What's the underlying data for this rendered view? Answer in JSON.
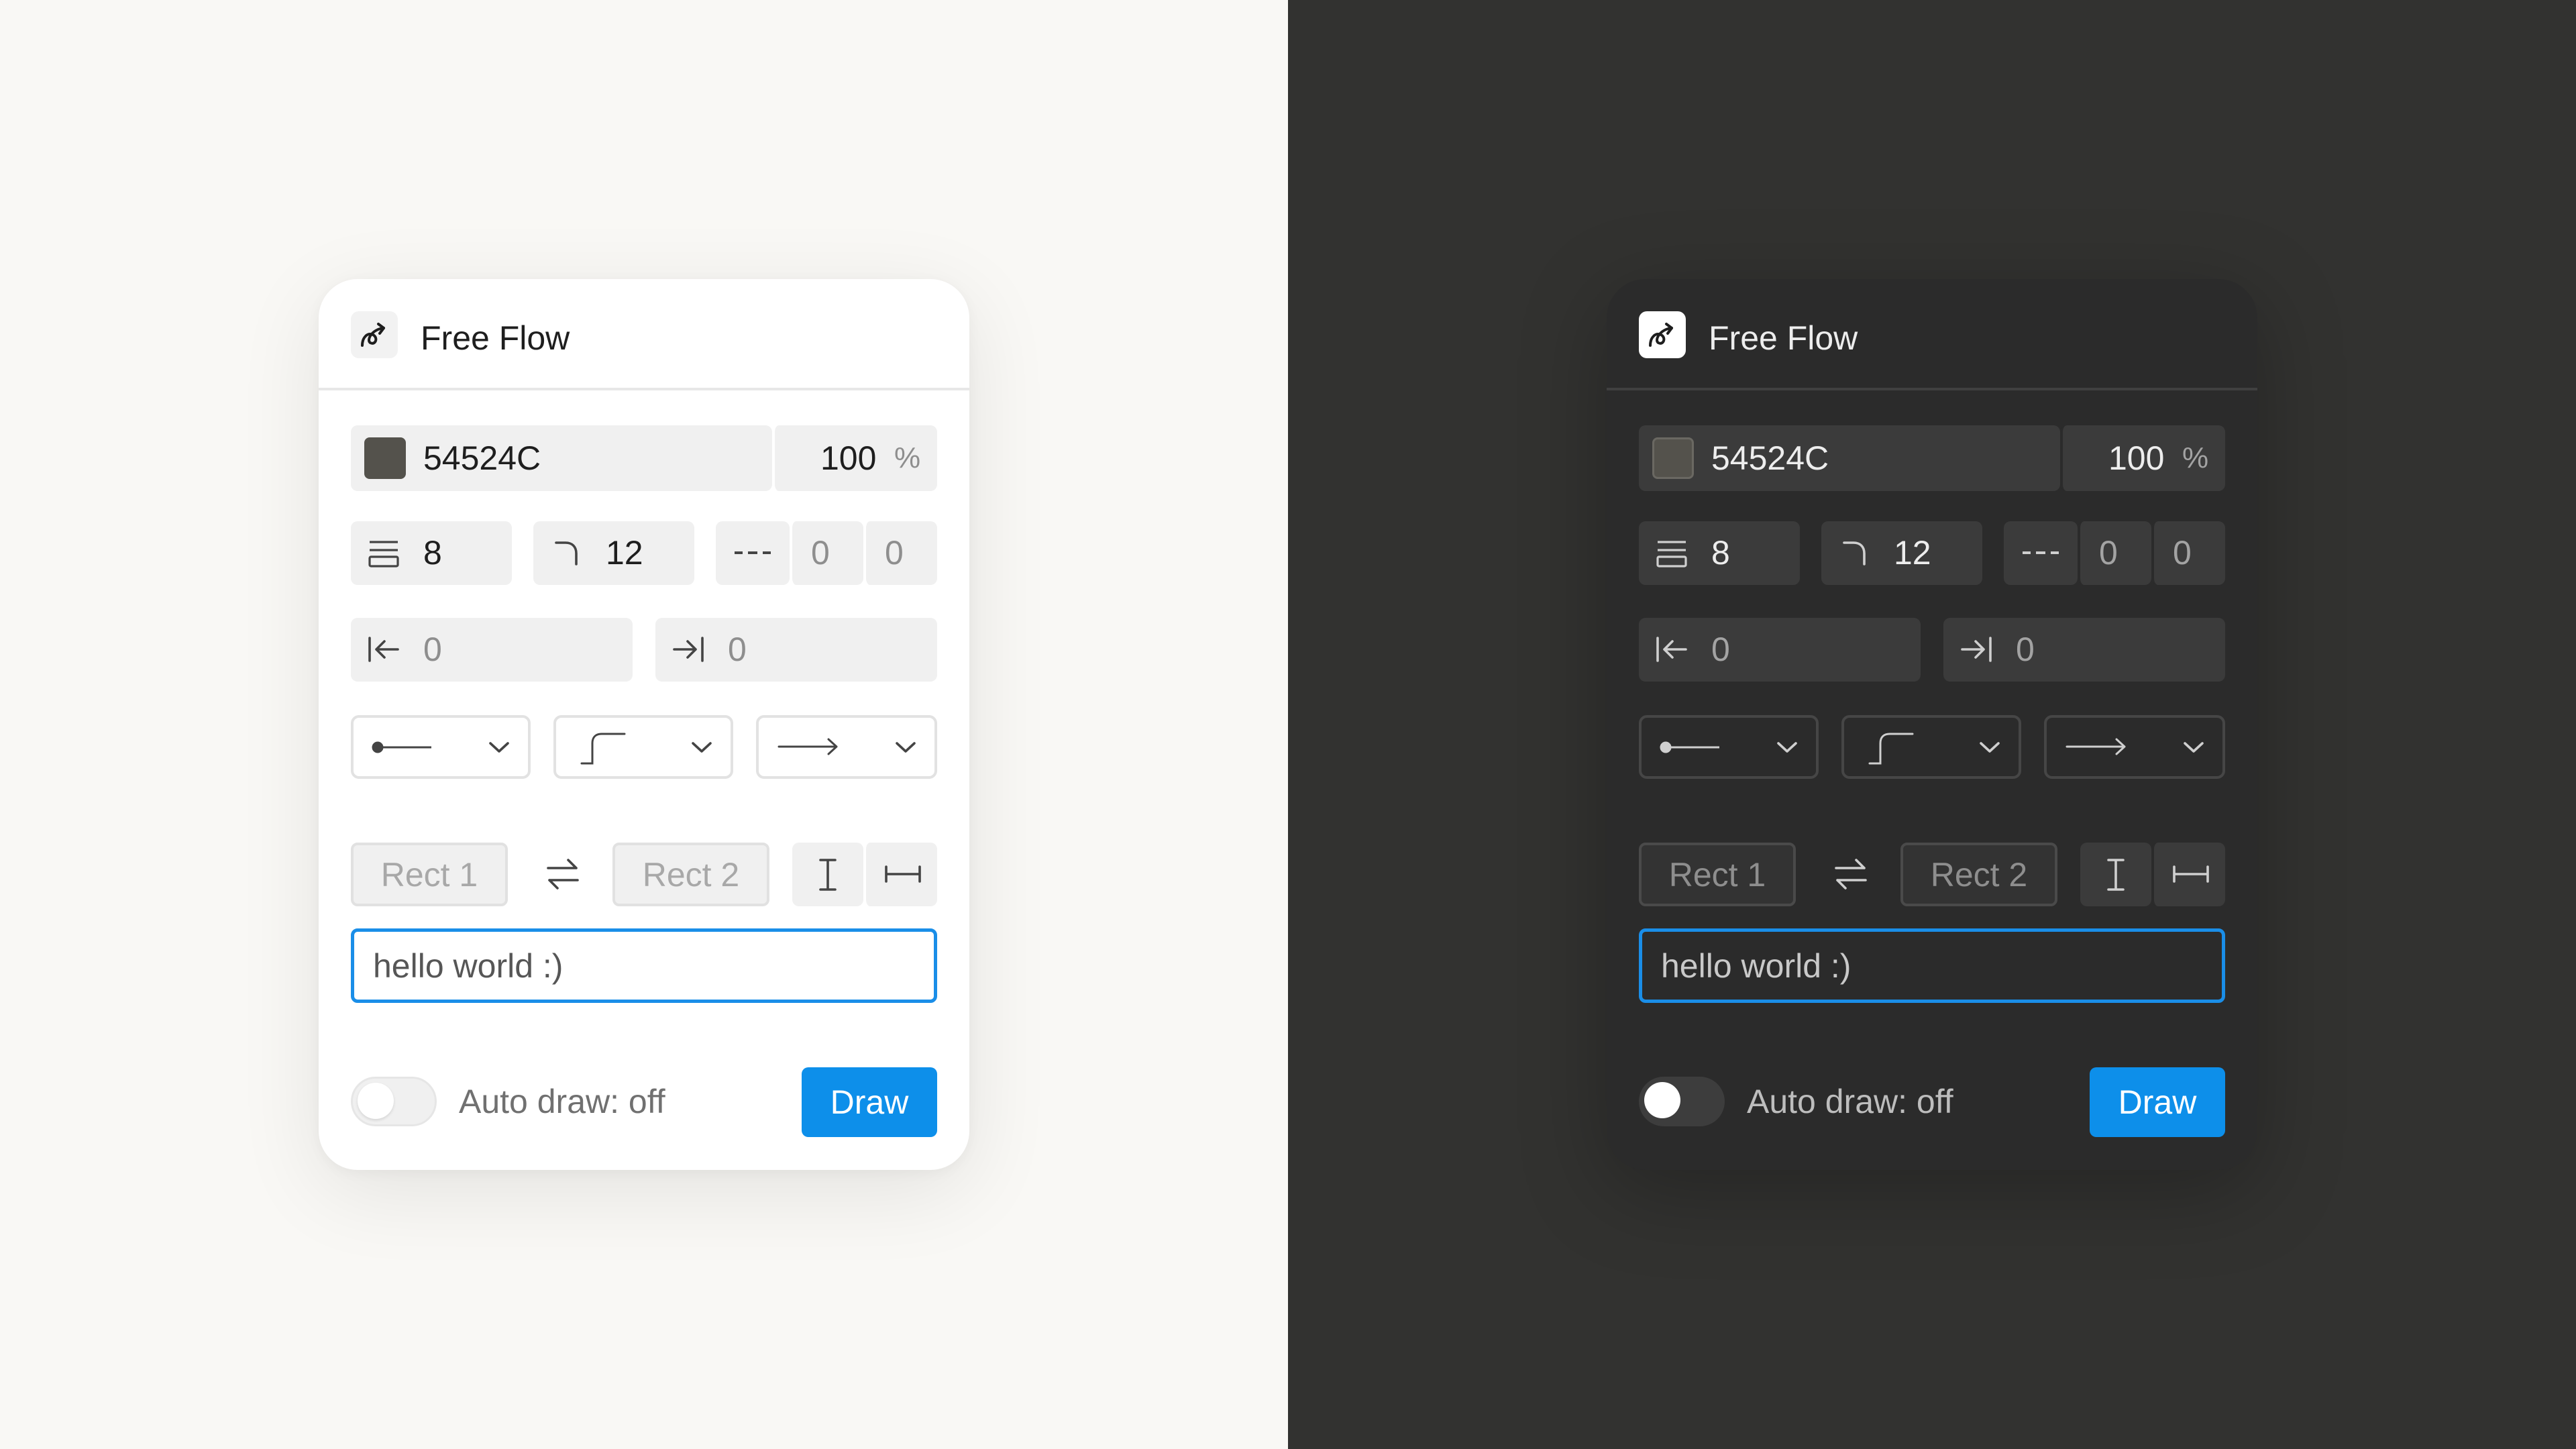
{
  "themes": [
    "light",
    "dark"
  ],
  "panel": {
    "title": "Free Flow",
    "logo_icon": "freeflow-curve-arrow-icon",
    "color": {
      "hex": "54524C",
      "swatch_color": "#54524C",
      "opacity": "100",
      "opacity_unit": "%"
    },
    "stroke": {
      "width_icon": "stroke-width-icon",
      "width": "8",
      "corner_icon": "corner-radius-icon",
      "radius": "12",
      "dash_icon": "dash-pattern-icon",
      "dash": "0",
      "gap": "0"
    },
    "padding": {
      "start_icon": "padding-start-icon",
      "start": "0",
      "end_icon": "padding-end-icon",
      "end": "0"
    },
    "selects": [
      {
        "name": "start-cap",
        "icon": "dot-line-icon"
      },
      {
        "name": "line-style",
        "icon": "step-curve-icon"
      },
      {
        "name": "end-cap",
        "icon": "arrow-line-icon"
      }
    ],
    "connect": {
      "from": "Rect 1",
      "swap_icon": "swap-arrows-icon",
      "to": "Rect 2",
      "vertical_icon": "text-cursor-icon",
      "horizontal_icon": "horizontal-span-icon"
    },
    "label_input": {
      "value": "hello world :)"
    },
    "auto_draw": {
      "label": "Auto draw: off",
      "enabled": false
    },
    "draw_button": "Draw",
    "accent_color": "#1A8EE8"
  }
}
